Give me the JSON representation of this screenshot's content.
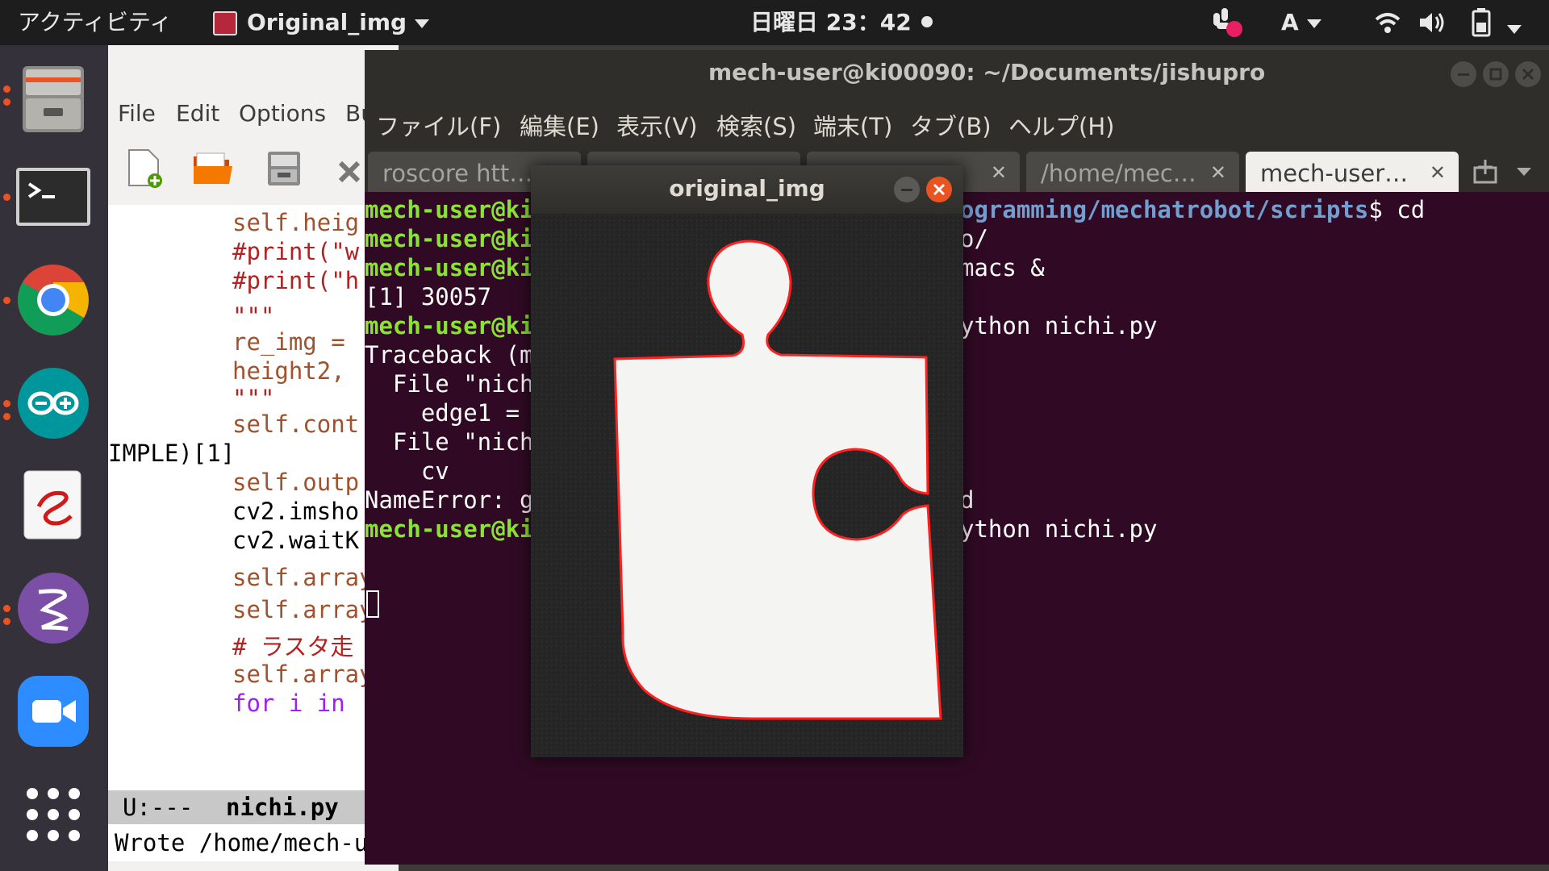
{
  "topbar": {
    "activities": "アクティビティ",
    "app_name": "Original_img",
    "clock": "日曜日 23：42",
    "input_method": "A"
  },
  "dock": {
    "items": [
      "files",
      "terminal",
      "chrome",
      "arduino",
      "emacs-e",
      "emacs-gnu",
      "zoom",
      "show-apps"
    ]
  },
  "emacs": {
    "menu": [
      "File",
      "Edit",
      "Options",
      "Bu"
    ],
    "code": [
      {
        "text": "self.heig",
        "style": "vn"
      },
      {
        "text": "#print(\"w",
        "style": "cm"
      },
      {
        "text": "#print(\"h",
        "style": "cm"
      },
      {
        "text": "\"\"\"",
        "style": "cm"
      },
      {
        "text": "re_img = ",
        "style": "vn"
      },
      {
        "text": "height2, ",
        "style": "vn"
      },
      {
        "text": "\"\"\"",
        "style": "cm"
      },
      {
        "text": "self.cont",
        "style": "vn"
      },
      {
        "text": "IMPLE)[1]",
        "style": "tx"
      },
      {
        "text": "self.outp",
        "style": "vn"
      },
      {
        "text": "cv2.imsho",
        "style": "tx"
      },
      {
        "text": "cv2.waitK",
        "style": "tx"
      },
      {
        "text": "self.array",
        "style": "vn"
      },
      {
        "text": "self.array",
        "style": "vn"
      },
      {
        "text": "# ラスタ走",
        "style": "cm"
      },
      {
        "text": "self.array",
        "style": "vn"
      },
      {
        "text": "for i in ",
        "style": "kw"
      }
    ],
    "modeline_status": "U:---",
    "modeline_file": "nichi.py",
    "minibuffer": "Wrote /home/mech-u"
  },
  "terminal": {
    "title": "mech-user@ki00090: ~/Documents/jishupro",
    "menu": [
      "ファイル(F)",
      "編集(E)",
      "表示(V)",
      "検索(S)",
      "端末(T)",
      "タブ(B)",
      "ヘルプ(H)"
    ],
    "tabs": [
      {
        "label": "roscore htt…",
        "active": false
      },
      {
        "label": "",
        "active": false
      },
      {
        "label": "",
        "active": false
      },
      {
        "label": "/home/mec…",
        "active": false
      },
      {
        "label": "mech-user…",
        "active": true
      }
    ],
    "lines": [
      {
        "left": "mech-user@ki",
        "left_style": "pg",
        "right": "ogramming/mechatrobot/scripts",
        "right_style": "pb",
        "right_tail": "$ cd"
      },
      {
        "left": "mech-user@ki",
        "left_style": "pg",
        "right": "o/",
        "right_style": "",
        "right_tail": ""
      },
      {
        "left": "mech-user@ki",
        "left_style": "pg",
        "right": "macs &",
        "right_style": "",
        "right_tail": ""
      },
      {
        "left": "[1] 30057",
        "left_style": "",
        "right": "",
        "right_style": "",
        "right_tail": ""
      },
      {
        "left": "mech-user@ki",
        "left_style": "pg",
        "right": "ython nichi.py",
        "right_style": "",
        "right_tail": ""
      },
      {
        "left": "Traceback (m",
        "left_style": "",
        "right": "",
        "right_style": "",
        "right_tail": ""
      },
      {
        "left": "  File \"nich",
        "left_style": "",
        "right": "",
        "right_style": "",
        "right_tail": ""
      },
      {
        "left": "    edge1 = ",
        "left_style": "",
        "right": "",
        "right_style": "",
        "right_tail": ""
      },
      {
        "left": "  File \"nich",
        "left_style": "",
        "right": "",
        "right_style": "",
        "right_tail": ""
      },
      {
        "left": "    cv",
        "left_style": "",
        "right": "",
        "right_style": "",
        "right_tail": ""
      },
      {
        "left": "NameError: g",
        "left_style": "",
        "right": "d",
        "right_style": "",
        "right_tail": ""
      },
      {
        "left": "mech-user@ki",
        "left_style": "pg",
        "right": "ython nichi.py",
        "right_style": "",
        "right_tail": ""
      }
    ]
  },
  "image_window": {
    "title": "original_img"
  },
  "colors": {
    "terminal_bg": "#300a24",
    "prompt_green": "#8ae234",
    "path_blue": "#729fcf",
    "contour_red": "#ff2020"
  }
}
